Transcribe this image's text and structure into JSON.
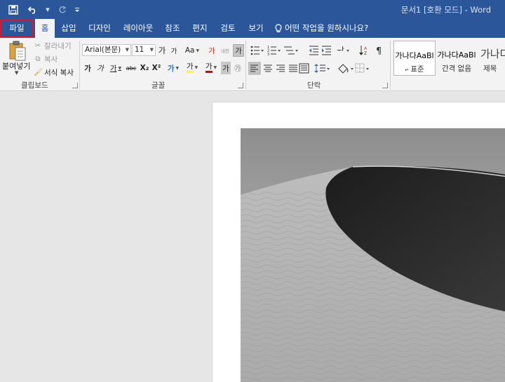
{
  "title_bar": {
    "title": "문서1 [호환 모드]  -  Word"
  },
  "quick_access": {
    "save_icon": "save-icon",
    "undo_icon": "undo-icon",
    "redo_icon": "redo-icon",
    "customize_icon": "customize-qat-icon"
  },
  "tabs": {
    "file": "파일",
    "home": "홈",
    "insert": "삽입",
    "design": "디자인",
    "layout": "레이아웃",
    "references": "참조",
    "mailings": "편지",
    "review": "검토",
    "view": "보기",
    "tell_me": "어떤 작업을 원하시나요?"
  },
  "clipboard": {
    "paste": "붙여넣기",
    "cut": "잘라내기",
    "copy": "복사",
    "format_painter": "서식 복사",
    "group_label": "클립보드"
  },
  "font": {
    "name": "Arial(본문)",
    "size": "11",
    "grow": "가",
    "shrink": "가",
    "case": "Aa",
    "clear": "가",
    "phonetic": "내천",
    "border": "가",
    "bold": "가",
    "italic": "가",
    "underline": "가",
    "strike": "abc",
    "subscript": "X₂",
    "superscript": "X²",
    "effects": "가",
    "highlight": "가",
    "color": "가",
    "shade": "가",
    "enclose": "㉮",
    "group_label": "글꼴"
  },
  "paragraph": {
    "group_label": "단락"
  },
  "styles": {
    "items": [
      {
        "sample": "가나다AaBl",
        "name": "표준"
      },
      {
        "sample": "가나다AaBl",
        "name": "간격 없음"
      },
      {
        "sample": "가나다",
        "name": "제목"
      }
    ]
  },
  "colors": {
    "brand": "#2b579a",
    "highlight": "#ffff00",
    "font_color": "#e00000",
    "file_tab_outline": "#e81123"
  }
}
